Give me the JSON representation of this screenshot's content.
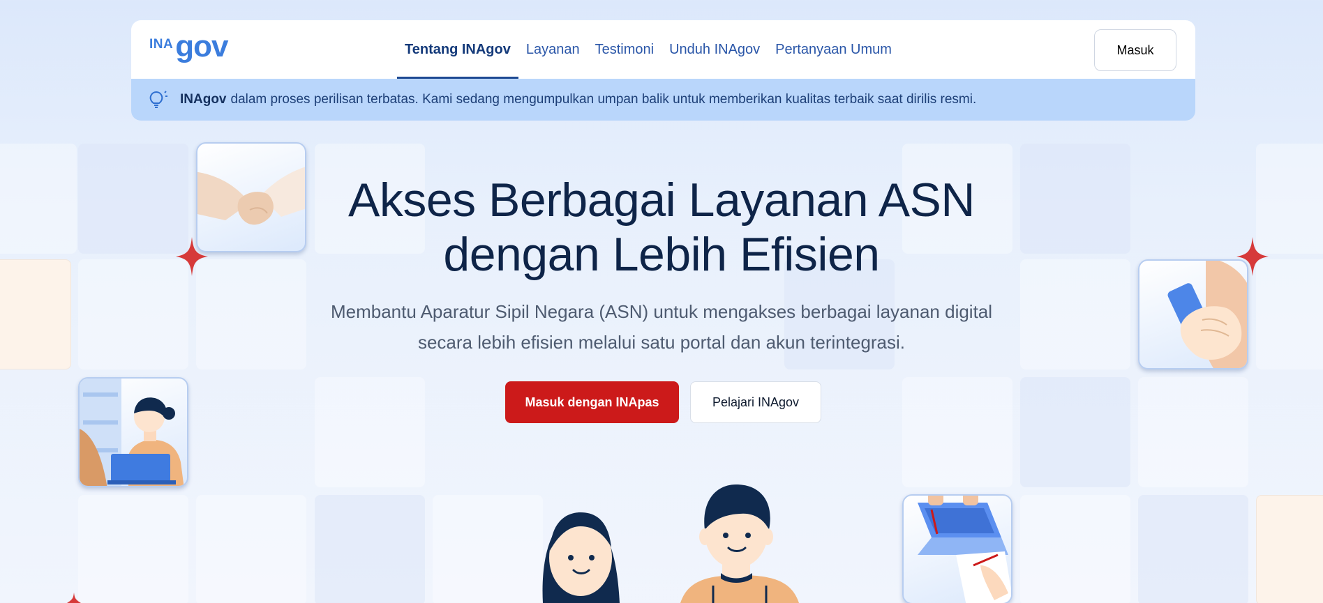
{
  "nav": {
    "logo": {
      "prefix": "INA",
      "word": "gov"
    },
    "items": [
      {
        "label": "Tentang INAgov",
        "active": true
      },
      {
        "label": "Layanan",
        "active": false
      },
      {
        "label": "Testimoni",
        "active": false
      },
      {
        "label": "Unduh INAgov",
        "active": false
      },
      {
        "label": "Pertanyaan Umum",
        "active": false
      }
    ],
    "login_label": "Masuk"
  },
  "banner": {
    "icon": "lightbulb-icon",
    "brand": "INAgov",
    "message": "dalam proses perilisan terbatas. Kami sedang mengumpulkan umpan balik untuk memberikan kualitas terbaik saat dirilis resmi."
  },
  "hero": {
    "title_line1": "Akses Berbagai Layanan ASN",
    "title_line2": "dengan Lebih Efisien",
    "subtitle_line1": "Membantu Aparatur Sipil Negara (ASN) untuk mengakses berbagai layanan digital",
    "subtitle_line2": "secara lebih efisien melalui satu portal dan akun terintegrasi.",
    "primary_cta": "Masuk dengan INApas",
    "secondary_cta": "Pelajari INAgov"
  },
  "colors": {
    "accent_red": "#cc1a1a",
    "brand_blue": "#3b7ddd",
    "banner_bg": "#b9d6fb",
    "title_navy": "#0e2448"
  }
}
